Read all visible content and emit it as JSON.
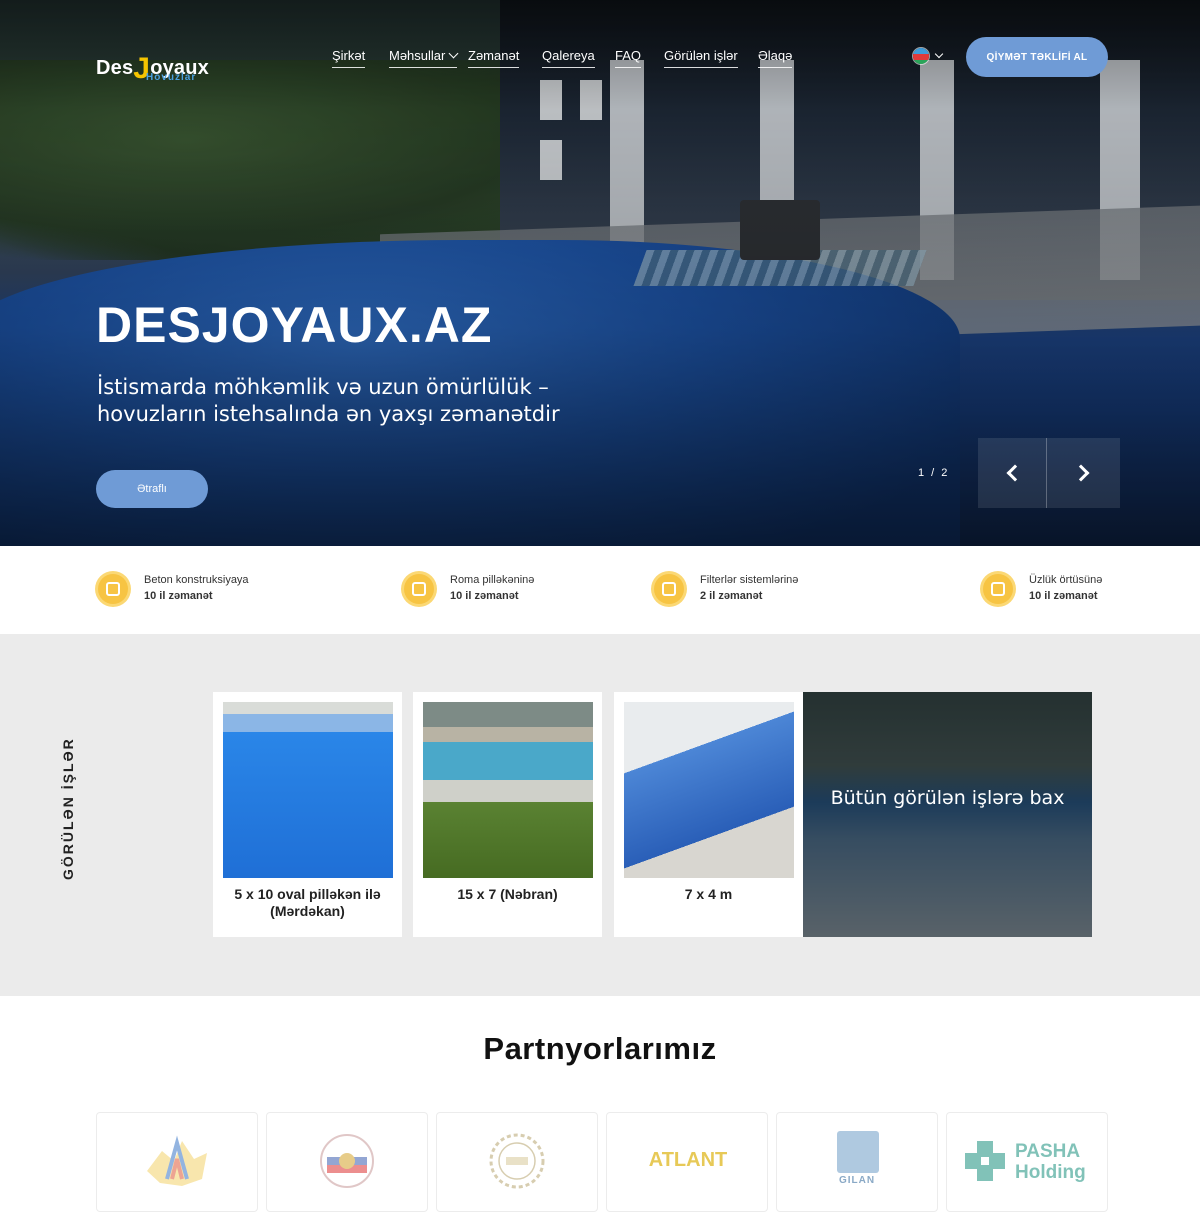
{
  "header": {
    "logo_brand_pre": "Des",
    "logo_brand_j": "J",
    "logo_brand_post": "oyaux",
    "logo_sub": "Hovuzlar",
    "nav": [
      {
        "label": "Şirkət"
      },
      {
        "label": "Məhsullar",
        "has_dropdown": true
      },
      {
        "label": "Zəmanət"
      },
      {
        "label": "Qalereya"
      },
      {
        "label": "FAQ"
      },
      {
        "label": "Görülən işlər"
      },
      {
        "label": "Əlaqə"
      }
    ],
    "language_icon": "azerbaijan-flag-icon",
    "quote_button": "QİYMƏT TƏKLİFİ AL"
  },
  "hero": {
    "title": "DESJOYAUX.AZ",
    "subtitle": "İstismarda möhkəmlik və uzun ömürlülük – hovuzların istehsalında ən yaxşı zəmanətdir",
    "more_button": "Ətraflı",
    "slide_counter": "1 / 2"
  },
  "guarantees": [
    {
      "title": "Beton konstruksiyaya",
      "term": "10 il zəmanət",
      "icon": "hand-badge-icon"
    },
    {
      "title": "Roma pilləkəninə",
      "term": "10 il zəmanət",
      "icon": "stairs-badge-icon"
    },
    {
      "title": "Filterlər sistemlərinə",
      "term": "2 il zəmanət",
      "icon": "filter-badge-icon"
    },
    {
      "title": "Üzlük örtüsünə",
      "term": "10 il zəmanət",
      "icon": "pool-cover-badge-icon"
    }
  ],
  "works": {
    "section_label": "GÖRÜLƏN İŞLƏR",
    "items": [
      {
        "caption": "5 x 10 oval pilləkən ilə (Mərdəkan)"
      },
      {
        "caption": "15 x 7 (Nəbran)"
      },
      {
        "caption": "7 x 4 m"
      }
    ],
    "view_all": "Bütün görülən işlərə bax"
  },
  "partners": {
    "title": "Partnyorlarımız",
    "items": [
      {
        "name": "azerbaijan-map-logo"
      },
      {
        "name": "russia-emblem-logo"
      },
      {
        "name": "laurel-seal-logo"
      },
      {
        "text": "ATLANT"
      },
      {
        "text": "GILAN"
      },
      {
        "text": "PASHA Holding"
      }
    ]
  },
  "colors": {
    "accent_blue": "#6f9bd6",
    "logo_yellow": "#f5c400",
    "badge_yellow": "#f7c443"
  }
}
